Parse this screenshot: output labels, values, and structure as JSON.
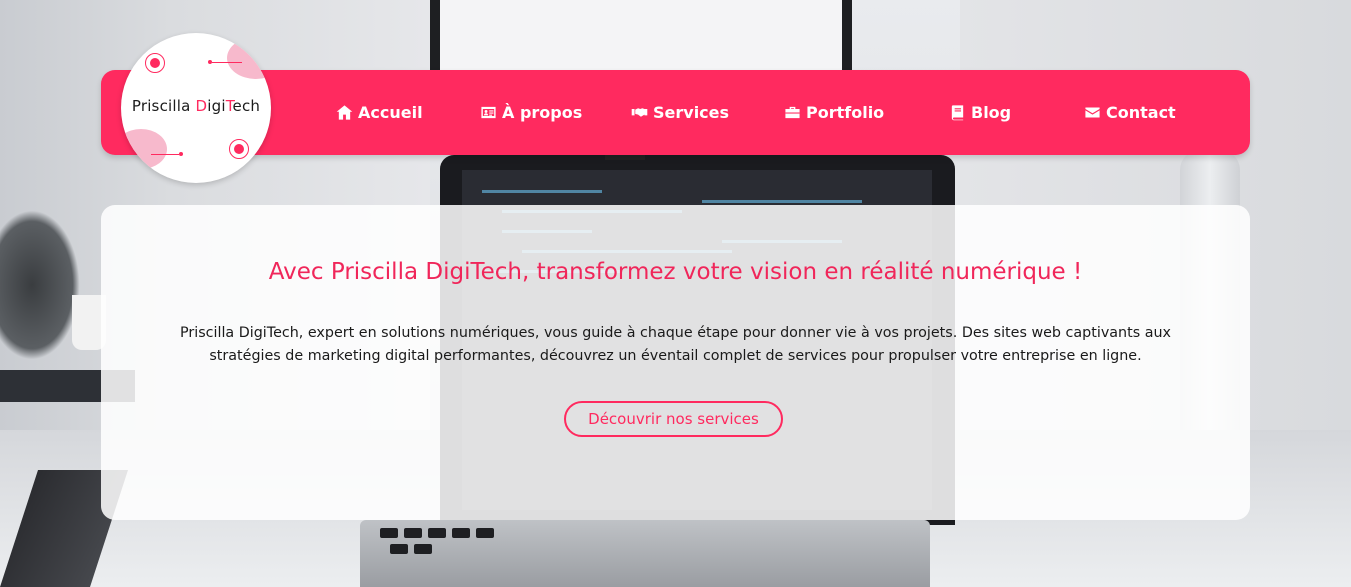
{
  "brand": {
    "name_part1": "Priscilla ",
    "name_accent1": "D",
    "name_part2": "igi",
    "name_accent2": "T",
    "name_part3": "ech"
  },
  "nav": {
    "items": [
      {
        "label": "Accueil",
        "icon": "home-icon"
      },
      {
        "label": "À propos",
        "icon": "id-card-icon"
      },
      {
        "label": "Services",
        "icon": "handshake-icon"
      },
      {
        "label": "Portfolio",
        "icon": "briefcase-icon"
      },
      {
        "label": "Blog",
        "icon": "book-icon"
      },
      {
        "label": "Contact",
        "icon": "envelope-icon"
      }
    ]
  },
  "hero": {
    "title": "Avec Priscilla DigiTech, transformez votre vision en réalité numérique !",
    "description_line1": "Priscilla DigiTech, expert en solutions numériques, vous guide à chaque étape pour donner vie à vos projets. Des sites web captivants aux",
    "description_line2": "stratégies de marketing digital performantes, découvrez un éventail complet de services pour propulser votre entreprise en ligne.",
    "cta_label": "Découvrir nos services"
  },
  "colors": {
    "brand": "#ff2a5f",
    "nav_text": "#ffffff",
    "hero_text": "#1a1a1a"
  }
}
